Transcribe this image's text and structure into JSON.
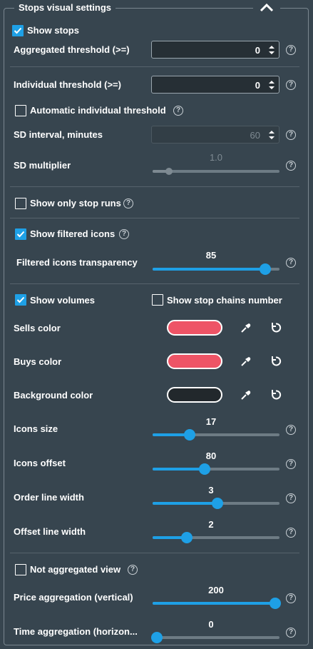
{
  "panel": {
    "title": "Stops visual settings"
  },
  "colors": {
    "accent": "#1ea0e6",
    "sells": "#ee5466",
    "buys": "#ee5466",
    "background": "#22282c"
  },
  "show_stops": {
    "label": "Show stops",
    "checked": true
  },
  "aggregated_threshold": {
    "label": "Aggregated threshold (>=)",
    "value": "0"
  },
  "individual_threshold": {
    "label": "Individual threshold (>=)",
    "value": "0"
  },
  "auto_individual": {
    "label": "Automatic individual threshold",
    "checked": false
  },
  "sd_interval": {
    "label": "SD interval, minutes",
    "value": "60"
  },
  "sd_multiplier": {
    "label": "SD multiplier",
    "value": "1.0",
    "fraction": 0.13
  },
  "show_only_stop_runs": {
    "label": "Show only stop runs",
    "checked": false
  },
  "show_filtered_icons": {
    "label": "Show filtered icons",
    "checked": true
  },
  "filtered_icons_transparency": {
    "label": "Filtered icons transparency",
    "value": "85",
    "fraction": 0.89
  },
  "show_volumes": {
    "label": "Show volumes",
    "checked": true
  },
  "show_stop_chains": {
    "label": "Show stop chains number",
    "checked": false
  },
  "sells_color": {
    "label": "Sells color"
  },
  "buys_color": {
    "label": "Buys color"
  },
  "background_color": {
    "label": "Background color"
  },
  "icons_size": {
    "label": "Icons size",
    "value": "17",
    "fraction": 0.29
  },
  "icons_offset": {
    "label": "Icons offset",
    "value": "80",
    "fraction": 0.41
  },
  "order_line_width": {
    "label": "Order line width",
    "value": "3",
    "fraction": 0.51
  },
  "offset_line_width": {
    "label": "Offset line width",
    "value": "2",
    "fraction": 0.27
  },
  "not_aggregated_view": {
    "label": "Not aggregated view",
    "checked": false
  },
  "price_aggregation": {
    "label": "Price aggregation (vertical)",
    "value": "200",
    "fraction": 1.0
  },
  "time_aggregation": {
    "label": "Time aggregation (horizon...",
    "value": "0",
    "fraction": 0.0
  },
  "help_glyph": "?"
}
